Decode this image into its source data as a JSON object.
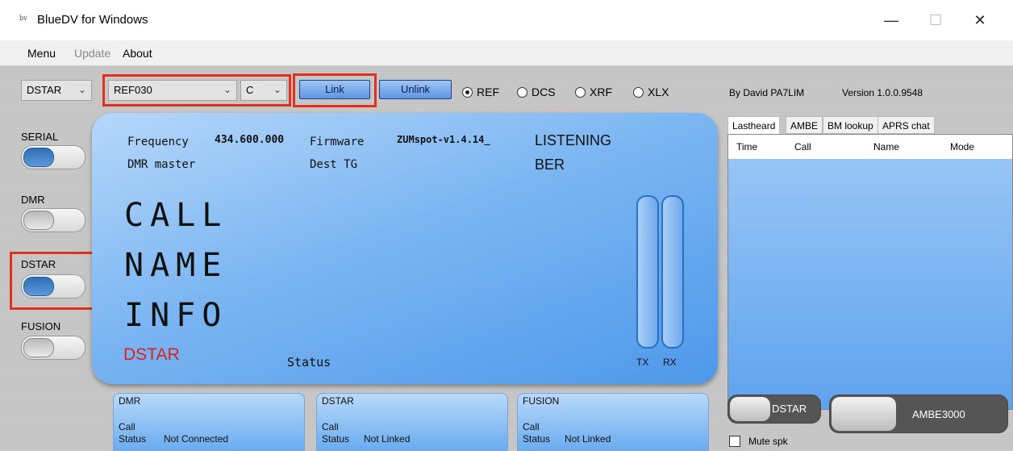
{
  "window": {
    "title": "BlueDV for Windows",
    "logo_text": "bv",
    "minimize": "—",
    "maximize": "☐",
    "close": "✕"
  },
  "menu": {
    "items": [
      "Menu",
      "Update",
      "About"
    ]
  },
  "toolbar": {
    "mode_select": "DSTAR",
    "reflector_select": "REF030",
    "module_select": "C",
    "link_label": "Link",
    "unlink_label": "Unlink",
    "radio_options": [
      "REF",
      "DCS",
      "XRF",
      "XLX"
    ],
    "radio_selected": "REF",
    "author": "By David PA7LIM",
    "version": "Version 1.0.0.9548"
  },
  "side_toggles": [
    {
      "label": "SERIAL",
      "on": true
    },
    {
      "label": "DMR",
      "on": false
    },
    {
      "label": "DSTAR",
      "on": true
    },
    {
      "label": "FUSION",
      "on": false
    }
  ],
  "display": {
    "frequency_label": "Frequency",
    "frequency_value": "434.600.000",
    "firmware_label": "Firmware",
    "firmware_value": "ZUMspot-v1.4.14_",
    "state": "LISTENING",
    "dmr_master_label": "DMR master",
    "dest_tg_label": "Dest TG",
    "ber_label": "BER",
    "call": "CALL",
    "name": "NAME",
    "info": "INFO",
    "mode": "DSTAR",
    "status": "Status",
    "tx": "TX",
    "rx": "RX"
  },
  "tabs": [
    "Lastheard",
    "AMBE",
    "BM lookup",
    "APRS chat"
  ],
  "grid_columns": [
    "Time",
    "Call",
    "Name",
    "Mode"
  ],
  "bottom_panels": [
    {
      "title": "DMR",
      "call_label": "Call",
      "status_label": "Status",
      "status_value": "Not Connected"
    },
    {
      "title": "DSTAR",
      "call_label": "Call",
      "status_label": "Status",
      "status_value": "Not Linked"
    },
    {
      "title": "FUSION",
      "call_label": "Call",
      "status_label": "Status",
      "status_value": "Not Linked"
    }
  ],
  "bottom_right": {
    "dstar_toggle": "DSTAR",
    "ambe_toggle": "AMBE3000",
    "mute_label": "Mute spk"
  },
  "colors": {
    "accent": "#5e95e3",
    "highlight": "#e0301e",
    "display_mode": "#e0201a"
  }
}
